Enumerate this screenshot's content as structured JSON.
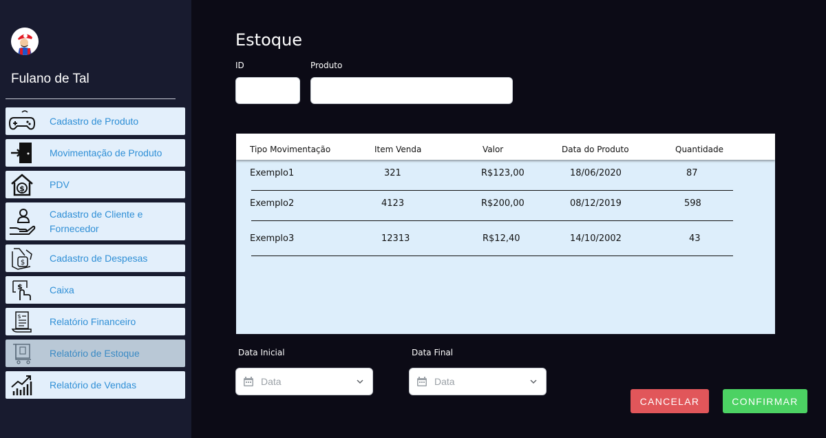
{
  "user": {
    "name": "Fulano de Tal"
  },
  "sidebar": {
    "items": [
      {
        "label": "Cadastro de Produto",
        "icon": "gamepad-icon",
        "active": false
      },
      {
        "label": "Movimentação de Produto",
        "icon": "door-enter-icon",
        "active": false
      },
      {
        "label": "PDV",
        "icon": "house-dollar-icon",
        "active": false
      },
      {
        "label": "Cadastro de Cliente e Fornecedor",
        "icon": "hand-person-icon",
        "active": false
      },
      {
        "label": "Cadastro de Despesas",
        "icon": "hand-money-icon",
        "active": false
      },
      {
        "label": "Caixa",
        "icon": "cash-icon",
        "active": false
      },
      {
        "label": "Relatório Financeiro",
        "icon": "report-icon",
        "active": false
      },
      {
        "label": "Relatório de Estoque",
        "icon": "box-cart-icon",
        "active": true
      },
      {
        "label": "Relatório de Vendas",
        "icon": "growth-chart-icon",
        "active": false
      }
    ]
  },
  "page": {
    "title": "Estoque"
  },
  "filters": {
    "id_label": "ID",
    "id_value": "",
    "produto_label": "Produto",
    "produto_value": ""
  },
  "table": {
    "columns": [
      "Tipo Movimentação",
      "Item Venda",
      "Valor",
      "Data do Produto",
      "Quantidade"
    ],
    "rows": [
      [
        "Exemplo1",
        "321",
        "R$123,00",
        "18/06/2020",
        "87"
      ],
      [
        "Exemplo2",
        "4123",
        "R$200,00",
        "08/12/2019",
        "598"
      ],
      [
        "Exemplo3",
        "12313",
        "R$12,40",
        "14/10/2002",
        "43"
      ]
    ]
  },
  "dates": {
    "start_label": "Data Inicial",
    "start_placeholder": "Data",
    "end_label": "Data Final",
    "end_placeholder": "Data"
  },
  "actions": {
    "cancel_label": "CANCELAR",
    "confirm_label": "CONFIRMAR"
  },
  "colors": {
    "sidebar_bg": "#181b2f",
    "page_bg": "#0c0b16",
    "nav_item_bg": "#e3effb",
    "nav_item_active_bg": "#b9c8d6",
    "nav_label": "#2f8fd6",
    "table_bg": "#ddeefb",
    "cancel": "#e1565a",
    "confirm": "#4cd263"
  }
}
